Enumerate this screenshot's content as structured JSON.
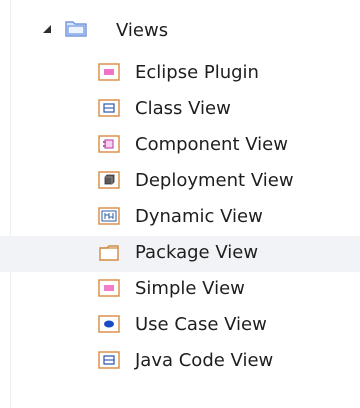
{
  "tree": {
    "root": {
      "label": "Views",
      "icon": "folder-package-icon"
    },
    "items": [
      {
        "label": "Eclipse Plugin",
        "icon": "eclipse-plugin-view-icon",
        "color": "#e15bb4"
      },
      {
        "label": "Class View",
        "icon": "class-view-icon",
        "color": "#3b63b8"
      },
      {
        "label": "Component View",
        "icon": "component-view-icon",
        "color": "#bf56b1"
      },
      {
        "label": "Deployment View",
        "icon": "deployment-view-icon",
        "color": "#4b4b4b"
      },
      {
        "label": "Dynamic View",
        "icon": "dynamic-view-icon",
        "color": "#2d5ea8"
      },
      {
        "label": "Package View",
        "icon": "package-view-icon",
        "color": "#cf8b43"
      },
      {
        "label": "Simple View",
        "icon": "simple-view-icon",
        "color": "#e06bb8"
      },
      {
        "label": "Use Case View",
        "icon": "use-case-view-icon",
        "color": "#1b4cc5"
      },
      {
        "label": "Java Code View",
        "icon": "java-code-view-icon",
        "color": "#375eb4"
      }
    ],
    "selected_item": "Package View"
  }
}
